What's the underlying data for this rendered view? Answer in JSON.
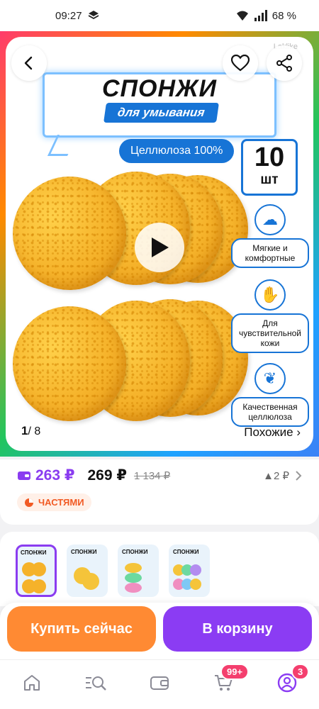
{
  "status_bar": {
    "time": "09:27",
    "battery": "68 %"
  },
  "hero": {
    "brand": "Laklike",
    "title": "СПОНЖИ",
    "subtitle": "для умывания",
    "material": "Целлюлоза 100%",
    "count_number": "10",
    "count_unit": "шт",
    "features": [
      {
        "icon": "cloud-hands-icon",
        "label": "Мягкие и комфортные"
      },
      {
        "icon": "hand-icon",
        "label": "Для чувствительной кожи"
      },
      {
        "icon": "leaf-icon",
        "label": "Качественная целлюлоза"
      }
    ],
    "page_current": "1",
    "page_total": "/ 8",
    "similar_label": "Похожие ›"
  },
  "pricing": {
    "wallet_price": "263 ₽",
    "price": "269 ₽",
    "old_price": "1 134 ₽",
    "price_change": "▲2 ₽",
    "installments_label": "ЧАСТЯМИ"
  },
  "variants": [
    {
      "title": "СПОНЖИ",
      "selected": true
    },
    {
      "title": "СПОНЖИ",
      "selected": false
    },
    {
      "title": "СПОНЖИ",
      "selected": false
    },
    {
      "title": "СПОНЖИ",
      "selected": false
    }
  ],
  "actions": {
    "buy_now": "Купить сейчас",
    "add_to_cart": "В корзину"
  },
  "nav": {
    "cart_badge": "99+",
    "profile_badge": "3"
  },
  "colors": {
    "accent_purple": "#8b3cf3",
    "accent_orange": "#ff8a33",
    "brand_blue": "#1774d6"
  }
}
